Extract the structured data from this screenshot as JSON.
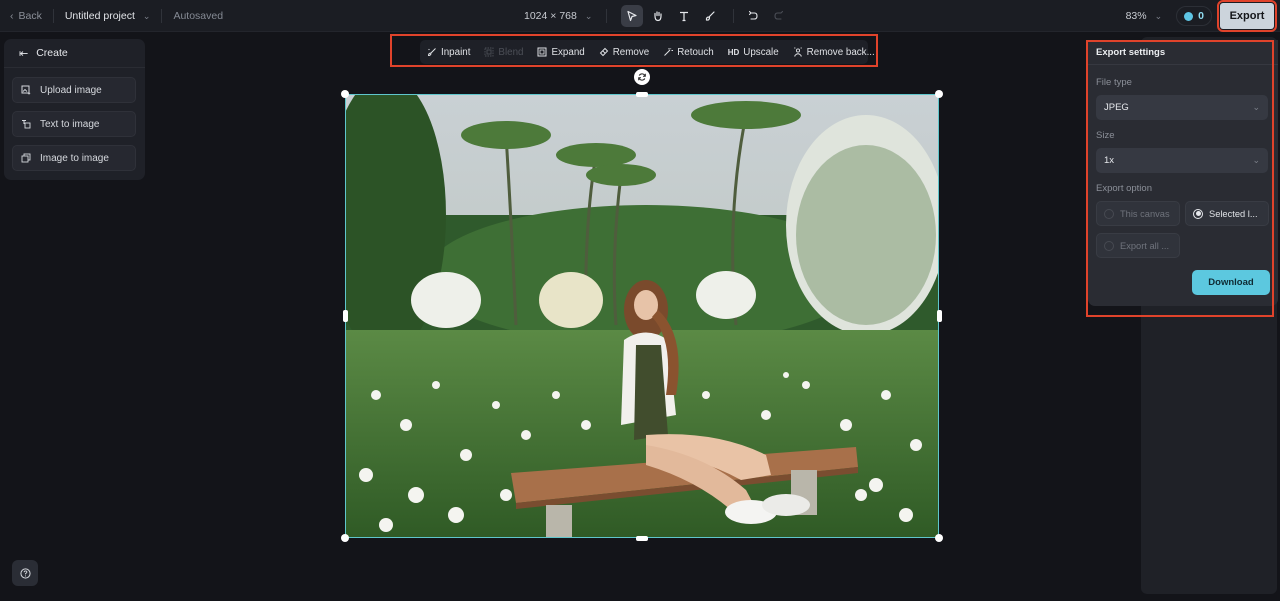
{
  "topbar": {
    "back_label": "Back",
    "project_name": "Untitled project",
    "autosave_status": "Autosaved",
    "canvas_size": "1024 × 768",
    "tools": [
      {
        "name": "select-tool",
        "icon": "cursor-icon",
        "active": true
      },
      {
        "name": "hand-tool",
        "icon": "hand-icon",
        "active": false
      },
      {
        "name": "text-tool",
        "icon": "text-icon",
        "active": false
      },
      {
        "name": "brush-tool",
        "icon": "brush-icon",
        "active": false
      }
    ],
    "zoom_level": "83%",
    "credits": "0",
    "export_label": "Export"
  },
  "create_panel": {
    "title": "Create",
    "items": [
      {
        "label": "Upload image",
        "icon": "upload-image-icon"
      },
      {
        "label": "Text to image",
        "icon": "text-to-image-icon"
      },
      {
        "label": "Image to image",
        "icon": "image-to-image-icon"
      }
    ]
  },
  "edit_toolbar": {
    "items": [
      {
        "label": "Inpaint",
        "icon": "inpaint-icon",
        "enabled": true
      },
      {
        "label": "Blend",
        "icon": "blend-icon",
        "enabled": false
      },
      {
        "label": "Expand",
        "icon": "expand-icon",
        "enabled": true
      },
      {
        "label": "Remove",
        "icon": "eraser-icon",
        "enabled": true
      },
      {
        "label": "Retouch",
        "icon": "magic-wand-icon",
        "enabled": true
      },
      {
        "label": "Upscale",
        "icon": "hd-icon",
        "icon_text": "HD",
        "enabled": true
      },
      {
        "label": "Remove back...",
        "icon": "remove-background-icon",
        "enabled": true
      }
    ]
  },
  "canvas": {
    "image_description": "Woman sitting on a wooden bench in a field of daisies with palm trees"
  },
  "export_settings": {
    "title": "Export settings",
    "file_type_label": "File type",
    "file_type_value": "JPEG",
    "size_label": "Size",
    "size_value": "1x",
    "export_option_label": "Export option",
    "options": [
      {
        "label": "This canvas",
        "selected": false
      },
      {
        "label": "Selected l...",
        "selected": true
      },
      {
        "label": "Export all ...",
        "selected": false
      }
    ],
    "download_label": "Download"
  },
  "colors": {
    "accent": "#5cc8df",
    "highlight": "#e0432b",
    "selection": "#5fc6cc"
  }
}
